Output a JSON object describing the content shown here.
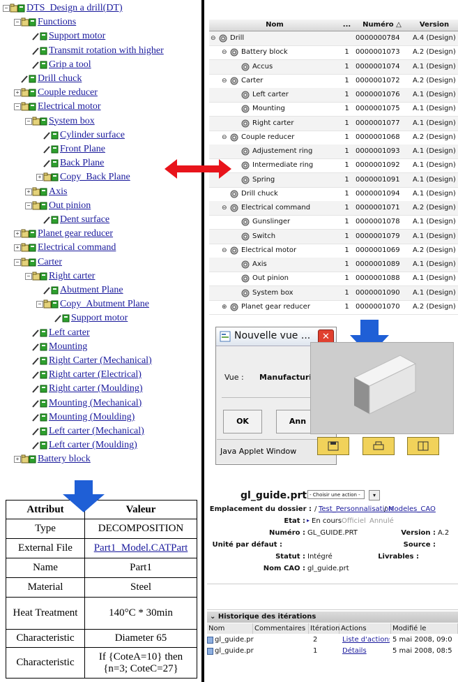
{
  "tree": [
    {
      "label": "DTS_Design a drill(DT)",
      "level": 0,
      "exp": "-",
      "icon": "folder"
    },
    {
      "label": "Functions",
      "level": 1,
      "exp": "-",
      "icon": "folder"
    },
    {
      "label": "Support motor",
      "level": 2,
      "exp": "",
      "icon": "pencil"
    },
    {
      "label": "Transmit rotation with higher",
      "level": 2,
      "exp": "",
      "icon": "pencil"
    },
    {
      "label": "Grip a tool",
      "level": 2,
      "exp": "",
      "icon": "pencil"
    },
    {
      "label": "Drill chuck",
      "level": 1,
      "exp": "",
      "icon": "pencil"
    },
    {
      "label": "Couple reducer",
      "level": 1,
      "exp": "+",
      "icon": "folder"
    },
    {
      "label": "Electrical motor",
      "level": 1,
      "exp": "-",
      "icon": "folder"
    },
    {
      "label": "System box",
      "level": 2,
      "exp": "-",
      "icon": "folder"
    },
    {
      "label": "Cylinder surface",
      "level": 3,
      "exp": "",
      "icon": "pencil"
    },
    {
      "label": "Front Plane",
      "level": 3,
      "exp": "",
      "icon": "pencil"
    },
    {
      "label": "Back Plane",
      "level": 3,
      "exp": "",
      "icon": "pencil"
    },
    {
      "label": "Copy_Back Plane",
      "level": 3,
      "exp": "+",
      "icon": "folder"
    },
    {
      "label": "Axis",
      "level": 2,
      "exp": "+",
      "icon": "folder"
    },
    {
      "label": "Out pinion",
      "level": 2,
      "exp": "-",
      "icon": "folder"
    },
    {
      "label": "Dent surface",
      "level": 3,
      "exp": "",
      "icon": "pencil"
    },
    {
      "label": "Planet gear reducer",
      "level": 1,
      "exp": "+",
      "icon": "folder"
    },
    {
      "label": "Electrical command",
      "level": 1,
      "exp": "+",
      "icon": "folder"
    },
    {
      "label": "Carter",
      "level": 1,
      "exp": "-",
      "icon": "folder"
    },
    {
      "label": "Right carter",
      "level": 2,
      "exp": "-",
      "icon": "folder"
    },
    {
      "label": "Abutment Plane",
      "level": 3,
      "exp": "",
      "icon": "pencil"
    },
    {
      "label": "Copy_Abutment Plane",
      "level": 3,
      "exp": "-",
      "icon": "folder"
    },
    {
      "label": "Support motor",
      "level": 4,
      "exp": "",
      "icon": "pencil"
    },
    {
      "label": "Left carter",
      "level": 2,
      "exp": "",
      "icon": "pencil"
    },
    {
      "label": "Mounting",
      "level": 2,
      "exp": "",
      "icon": "pencil"
    },
    {
      "label": "Right Carter (Mechanical)",
      "level": 2,
      "exp": "",
      "icon": "pencil"
    },
    {
      "label": "Right carter (Electrical)",
      "level": 2,
      "exp": "",
      "icon": "pencil"
    },
    {
      "label": "Right carter (Moulding)",
      "level": 2,
      "exp": "",
      "icon": "pencil"
    },
    {
      "label": "Mounting (Mechanical)",
      "level": 2,
      "exp": "",
      "icon": "pencil"
    },
    {
      "label": "Mounting (Moulding)",
      "level": 2,
      "exp": "",
      "icon": "pencil"
    },
    {
      "label": "Left carter (Mechanical)",
      "level": 2,
      "exp": "",
      "icon": "pencil"
    },
    {
      "label": "Left carter (Moulding)",
      "level": 2,
      "exp": "",
      "icon": "pencil"
    },
    {
      "label": "Battery block",
      "level": 1,
      "exp": "+",
      "icon": "folder"
    }
  ],
  "attributes": {
    "header_key": "Attribut",
    "header_value": "Valeur",
    "rows": [
      {
        "key": "Type",
        "value": "DECOMPOSITION",
        "link": false
      },
      {
        "key": "External File",
        "value": "Part1_Model.CATPart",
        "link": true
      },
      {
        "key": "Name",
        "value": "Part1",
        "link": false
      },
      {
        "key": "Material",
        "value": "Steel",
        "link": false
      },
      {
        "key": "Heat Treatment",
        "value": "140°C * 30min",
        "link": false
      },
      {
        "key": "Characteristic",
        "value": "Diameter 65",
        "link": false
      },
      {
        "key": "Characteristic",
        "value": "If {CoteA=10} then {n=3; CoteC=27}",
        "link": false
      }
    ]
  },
  "grid": {
    "headers": {
      "name": "Nom",
      "qty": "...",
      "number": "Numéro △",
      "version": "Version"
    },
    "rows": [
      {
        "name": "Drill",
        "qty": "",
        "number": "0000000784",
        "version": "A.4 (Design)",
        "level": 0,
        "exp": "-",
        "alt": true
      },
      {
        "name": "Battery block",
        "qty": "1",
        "number": "0000001073",
        "version": "A.2 (Design)",
        "level": 1,
        "exp": "-",
        "alt": false
      },
      {
        "name": "Accus",
        "qty": "1",
        "number": "0000001074",
        "version": "A.1 (Design)",
        "level": 2,
        "exp": "",
        "alt": true
      },
      {
        "name": "Carter",
        "qty": "1",
        "number": "0000001072",
        "version": "A.2 (Design)",
        "level": 1,
        "exp": "-",
        "alt": false
      },
      {
        "name": "Left carter",
        "qty": "1",
        "number": "0000001076",
        "version": "A.1 (Design)",
        "level": 2,
        "exp": "",
        "alt": true
      },
      {
        "name": "Mounting",
        "qty": "1",
        "number": "0000001075",
        "version": "A.1 (Design)",
        "level": 2,
        "exp": "",
        "alt": false
      },
      {
        "name": "Right carter",
        "qty": "1",
        "number": "0000001077",
        "version": "A.1 (Design)",
        "level": 2,
        "exp": "",
        "alt": true
      },
      {
        "name": "Couple reducer",
        "qty": "1",
        "number": "0000001068",
        "version": "A.2 (Design)",
        "level": 1,
        "exp": "-",
        "alt": false
      },
      {
        "name": "Adjustement ring",
        "qty": "1",
        "number": "0000001093",
        "version": "A.1 (Design)",
        "level": 2,
        "exp": "",
        "alt": true
      },
      {
        "name": "Intermediate ring",
        "qty": "1",
        "number": "0000001092",
        "version": "A.1 (Design)",
        "level": 2,
        "exp": "",
        "alt": false
      },
      {
        "name": "Spring",
        "qty": "1",
        "number": "0000001091",
        "version": "A.1 (Design)",
        "level": 2,
        "exp": "",
        "alt": true
      },
      {
        "name": "Drill chuck",
        "qty": "1",
        "number": "0000001094",
        "version": "A.1 (Design)",
        "level": 1,
        "exp": "",
        "alt": false
      },
      {
        "name": "Electrical command",
        "qty": "1",
        "number": "0000001071",
        "version": "A.2 (Design)",
        "level": 1,
        "exp": "-",
        "alt": true
      },
      {
        "name": "Gunslinger",
        "qty": "1",
        "number": "0000001078",
        "version": "A.1 (Design)",
        "level": 2,
        "exp": "",
        "alt": false
      },
      {
        "name": "Switch",
        "qty": "1",
        "number": "0000001079",
        "version": "A.1 (Design)",
        "level": 2,
        "exp": "",
        "alt": true
      },
      {
        "name": "Electrical motor",
        "qty": "1",
        "number": "0000001069",
        "version": "A.2 (Design)",
        "level": 1,
        "exp": "-",
        "alt": false
      },
      {
        "name": "Axis",
        "qty": "1",
        "number": "0000001089",
        "version": "A.1 (Design)",
        "level": 2,
        "exp": "",
        "alt": true
      },
      {
        "name": "Out pinion",
        "qty": "1",
        "number": "0000001088",
        "version": "A.1 (Design)",
        "level": 2,
        "exp": "",
        "alt": false
      },
      {
        "name": "System box",
        "qty": "1",
        "number": "0000001090",
        "version": "A.1 (Design)",
        "level": 2,
        "exp": "",
        "alt": true
      },
      {
        "name": "Planet gear reducer",
        "qty": "1",
        "number": "0000001070",
        "version": "A.2 (Design)",
        "level": 1,
        "exp": "+",
        "alt": false
      }
    ]
  },
  "dialog": {
    "title": "Nouvelle vue ...",
    "close": "✕",
    "vue_label": "Vue :",
    "vue_value": "Manufacturi",
    "ok": "OK",
    "cancel": "Ann",
    "status": "Java Applet Window"
  },
  "doc": {
    "filename": "gl_guide.prt",
    "action_placeholder": "- Choisir une action -",
    "folder_label": "Emplacement du dossier :",
    "folder_sep": "/",
    "folder_link1": "Test_Personnalisation",
    "folder_link2": "Modeles_CAO",
    "etat_label": "Etat :",
    "etat_current": "En cours",
    "etat_other1": "Officiel",
    "etat_other2": "Annulé",
    "numero_label": "Numéro :",
    "numero_value": "GL_GUIDE.PRT",
    "version_label": "Version :",
    "version_value": "A.2",
    "unite_label": "Unité par défaut :",
    "source_label": "Source :",
    "statut_label": "Statut :",
    "statut_value": "Intégré",
    "livrables_label": "Livrables :",
    "nomcao_label": "Nom CAO :",
    "nomcao_value": "gl_guide.prt",
    "history_title": "Historique des itérations",
    "history_headers": {
      "nom": "Nom",
      "comm": "Commentaires",
      "iter": "Itération",
      "actions": "Actions",
      "mod": "Modifié le"
    },
    "history_rows": [
      {
        "nom": "gl_guide.prt",
        "comm": "",
        "iter": "2",
        "actions": "Liste d'actions",
        "mod": "5 mai 2008, 09:0"
      },
      {
        "nom": "gl_guide.prt",
        "comm": "",
        "iter": "1",
        "actions": "Détails",
        "mod": "5 mai 2008, 08:5"
      }
    ]
  },
  "colors": {
    "arrow_red": "#e8141b",
    "arrow_blue": "#1f5fd6",
    "link": "#1a1a9c",
    "icon_green": "#2ea02e"
  }
}
